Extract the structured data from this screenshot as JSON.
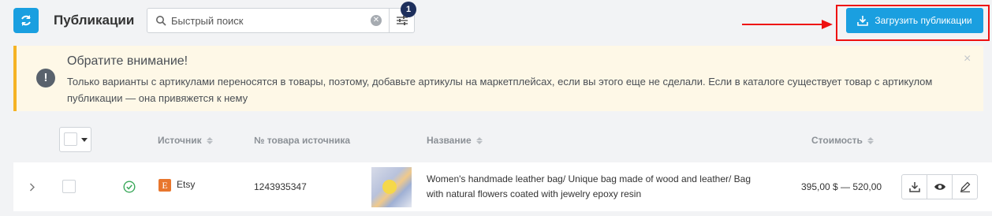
{
  "header": {
    "title": "Публикации",
    "search": {
      "placeholder": "Быстрый поиск",
      "value": ""
    },
    "filter_badge": "1",
    "upload_label": "Загрузить публикации"
  },
  "notice": {
    "title": "Обратите внимание!",
    "text": "Только варианты с артикулами переносятся в товары, поэтому, добавьте артикулы на маркетплейсах, если вы этого еще не сделали. Если в каталоге существует товар с артикулом публикации — она привяжется к нему",
    "close": "×",
    "icon": "!"
  },
  "table": {
    "columns": {
      "source": "Источник",
      "source_id": "№ товара источника",
      "name": "Название",
      "price": "Стоимость"
    },
    "rows": [
      {
        "source": "Etsy",
        "source_badge": "E",
        "source_id": "1243935347",
        "name": "Women's handmade leather bag/ Unique bag made of wood and leather/ Bag with natural flowers coated with jewelry epoxy resin",
        "price": "395,00 $ — 520,00"
      }
    ]
  },
  "colors": {
    "accent": "#1a9fe0",
    "notice_bg": "#fef8e7",
    "notice_border": "#f5b324",
    "highlight": "#ee1111",
    "status_ok": "#3aa85a"
  }
}
